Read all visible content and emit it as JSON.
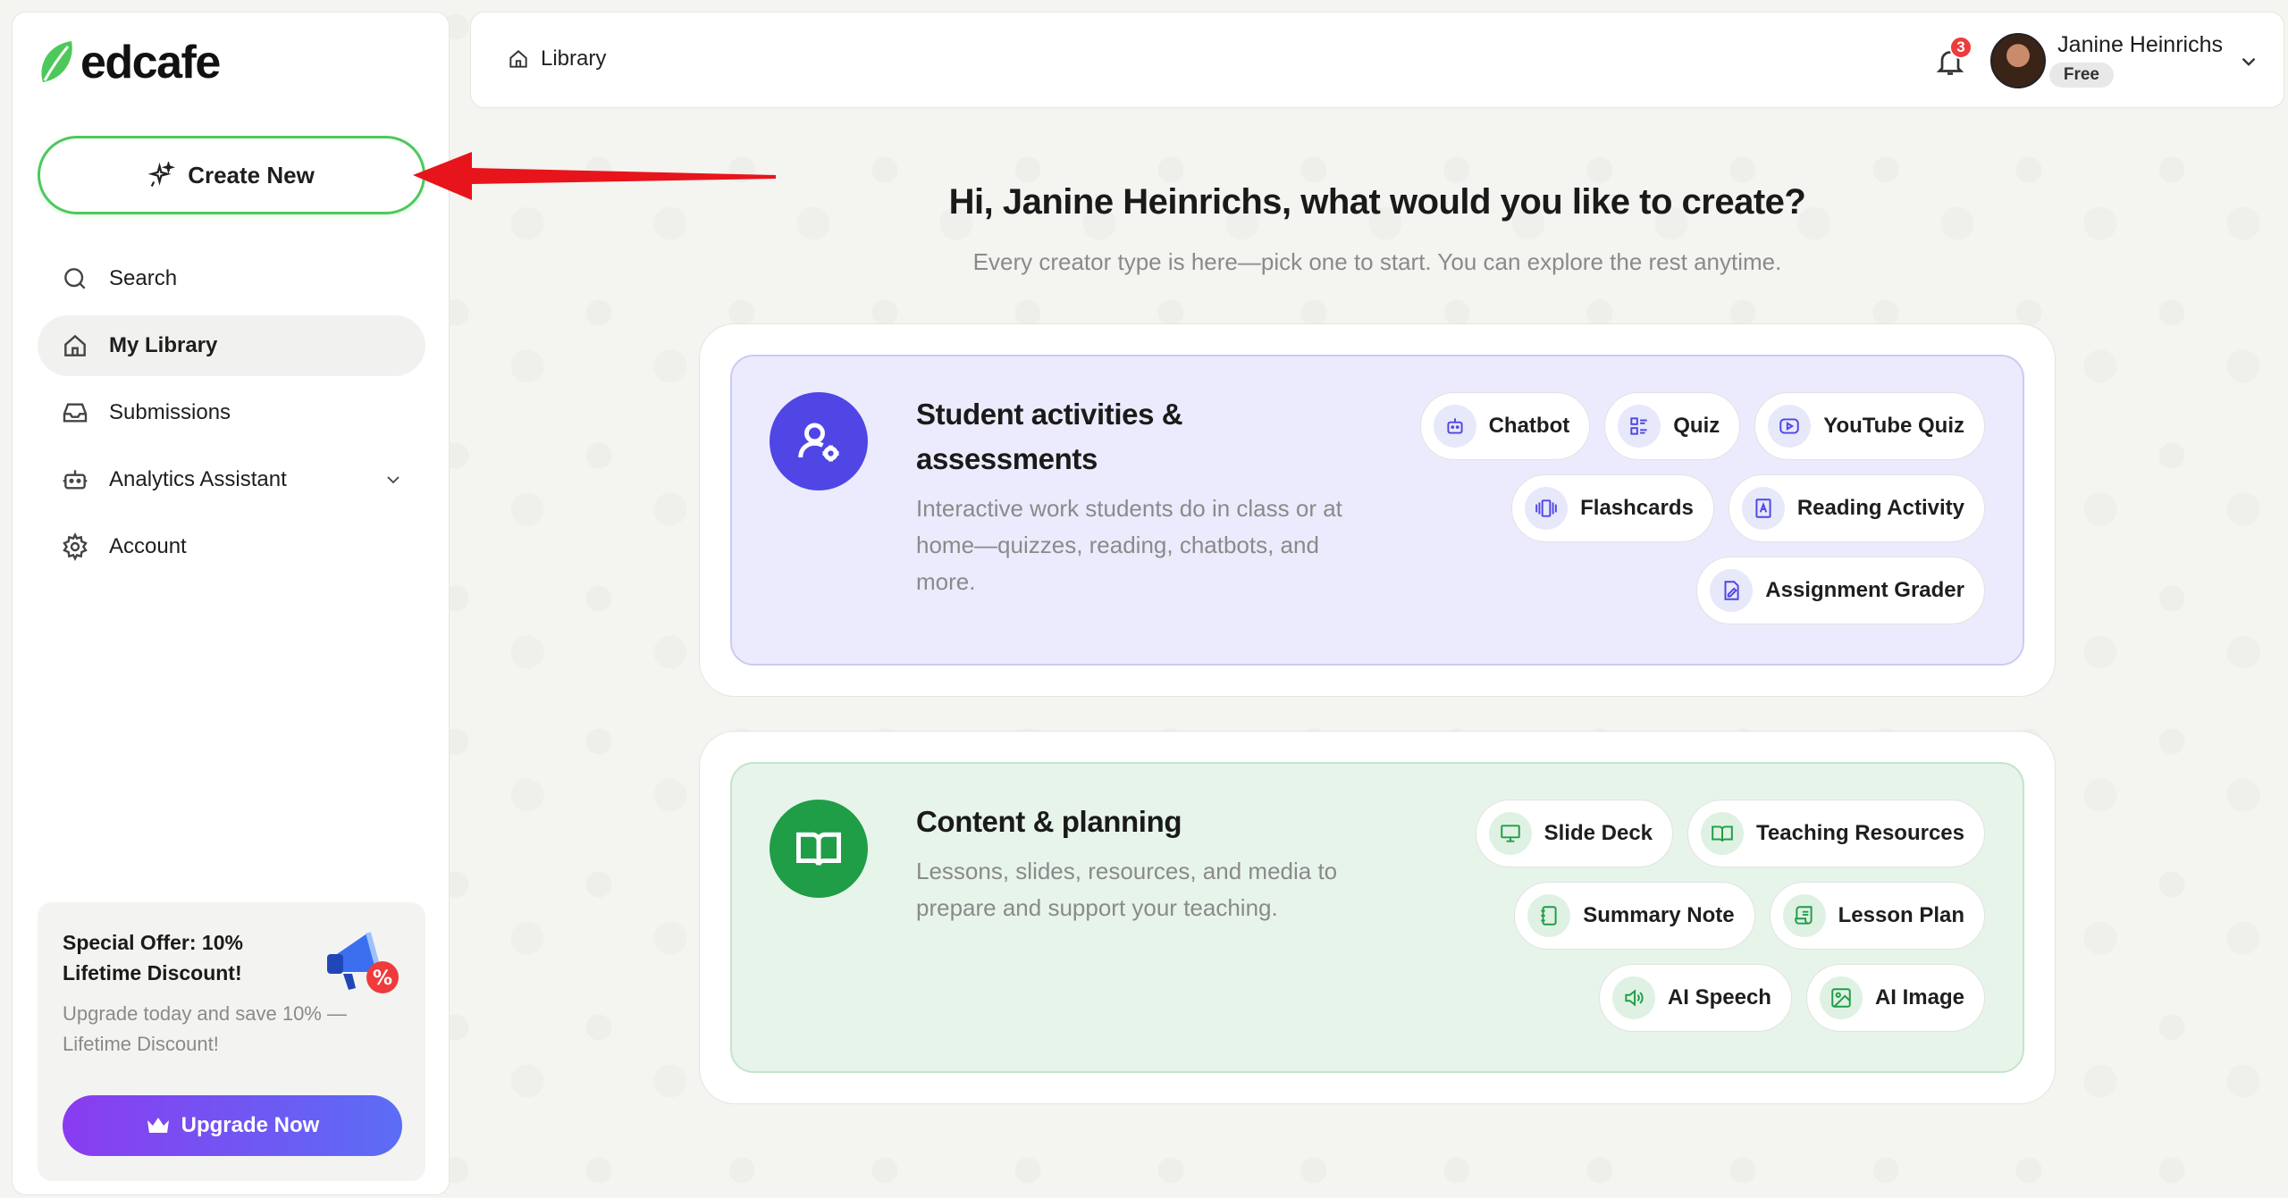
{
  "app": {
    "logo_text": "edcafe"
  },
  "sidebar": {
    "create_label": "Create New",
    "items": [
      {
        "label": "Search"
      },
      {
        "label": "My Library"
      },
      {
        "label": "Submissions"
      },
      {
        "label": "Analytics Assistant"
      },
      {
        "label": "Account"
      }
    ],
    "promo": {
      "title": "Special Offer: 10% Lifetime Discount!",
      "desc": "Upgrade today and save 10% — Lifetime Discount!",
      "button_label": "Upgrade Now"
    }
  },
  "topbar": {
    "breadcrumb": "Library",
    "notification_count": "3",
    "user_name": "Janine Heinrichs",
    "plan": "Free"
  },
  "main": {
    "heading": "Hi, Janine Heinrichs, what would you like to create?",
    "subheading": "Every creator type is here—pick one to start. You can explore the rest anytime.",
    "cards": [
      {
        "title": "Student activities & assessments",
        "desc": "Interactive work students do in class or at home—quizzes, reading, chatbots, and more.",
        "chips": [
          "Chatbot",
          "Quiz",
          "YouTube Quiz",
          "Flashcards",
          "Reading Activity",
          "Assignment Grader"
        ]
      },
      {
        "title": "Content & planning",
        "desc": "Lessons, slides, resources, and media to prepare and support your teaching.",
        "chips": [
          "Slide Deck",
          "Teaching Resources",
          "Summary Note",
          "Lesson Plan",
          "AI Speech",
          "AI Image"
        ]
      }
    ]
  },
  "colors": {
    "brand_green": "#4cc95a",
    "purple": "#4f46e5",
    "green": "#1f9d47",
    "annotation_red": "#e8141b"
  }
}
